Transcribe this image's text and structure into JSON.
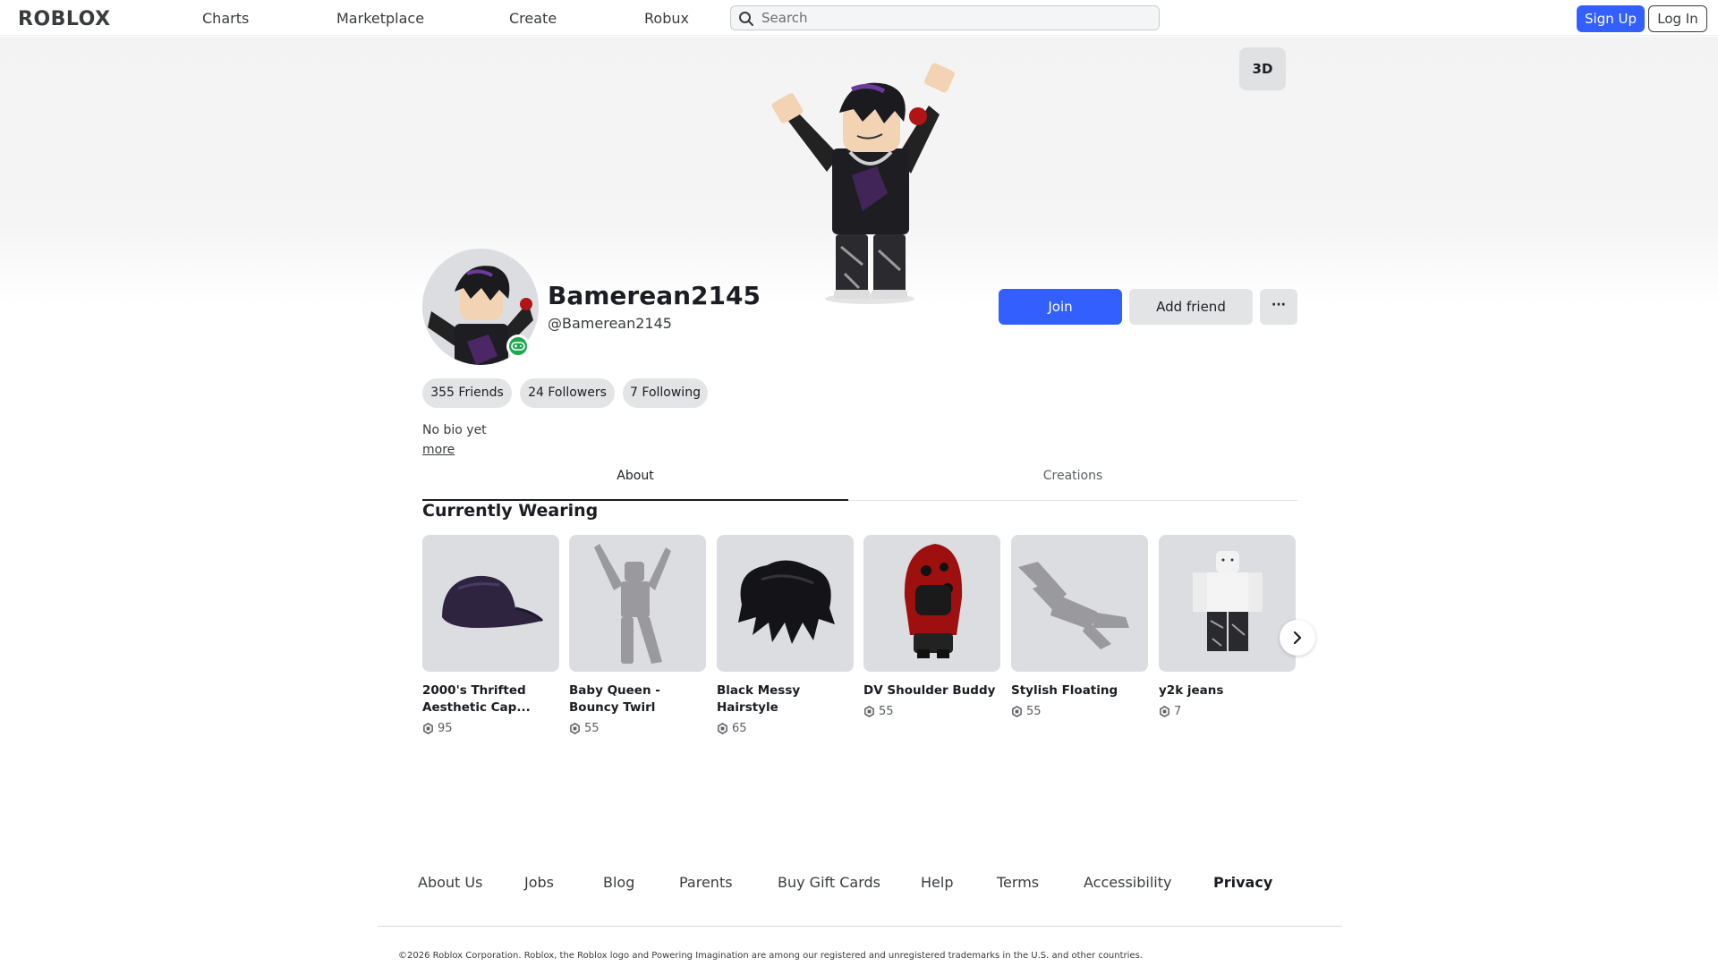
{
  "header": {
    "logo": "RΟBLOX",
    "nav": [
      "Charts",
      "Marketplace",
      "Create",
      "Robux"
    ],
    "search_placeholder": "Search",
    "signup_label": "Sign Up",
    "login_label": "Log In"
  },
  "hero": {
    "view_3d_label": "3D"
  },
  "profile": {
    "display_name": "Bamerean2145",
    "username": "@Bamerean2145",
    "join_label": "Join",
    "add_friend_label": "Add friend",
    "more_label": "···",
    "friends_label": "355 Friends",
    "followers_label": "24 Followers",
    "following_label": "7 Following",
    "bio": "No bio yet",
    "more_link": "more"
  },
  "tabs": [
    "About",
    "Creations"
  ],
  "wearing": {
    "title": "Currently Wearing",
    "items": [
      {
        "name": "2000's Thrifted Aesthetic Cap...",
        "price": "95",
        "icon": "cap-thumbnail"
      },
      {
        "name": "Baby Queen - Bouncy Twirl",
        "price": "55",
        "icon": "emote-figure-thumbnail"
      },
      {
        "name": "Black Messy Hairstyle",
        "price": "65",
        "icon": "hair-thumbnail"
      },
      {
        "name": "DV Shoulder Buddy",
        "price": "55",
        "icon": "shoulder-buddy-thumbnail"
      },
      {
        "name": "Stylish Floating",
        "price": "55",
        "icon": "floating-figure-thumbnail"
      },
      {
        "name": "y2k jeans",
        "price": "7",
        "icon": "jeans-avatar-thumbnail"
      }
    ]
  },
  "footer": {
    "links": [
      "About Us",
      "Jobs",
      "Blog",
      "Parents",
      "Buy Gift Cards",
      "Help",
      "Terms",
      "Accessibility",
      "Privacy"
    ],
    "copyright": "©2026 Roblox Corporation. Roblox, the Roblox logo and Powering Imagination are among our registered and unregistered trademarks in the U.S. and other countries."
  },
  "colors": {
    "accent": "#335fff",
    "online": "#1da851",
    "pill_bg": "#e3e4e6",
    "thumb_bg": "#dcdde1"
  }
}
